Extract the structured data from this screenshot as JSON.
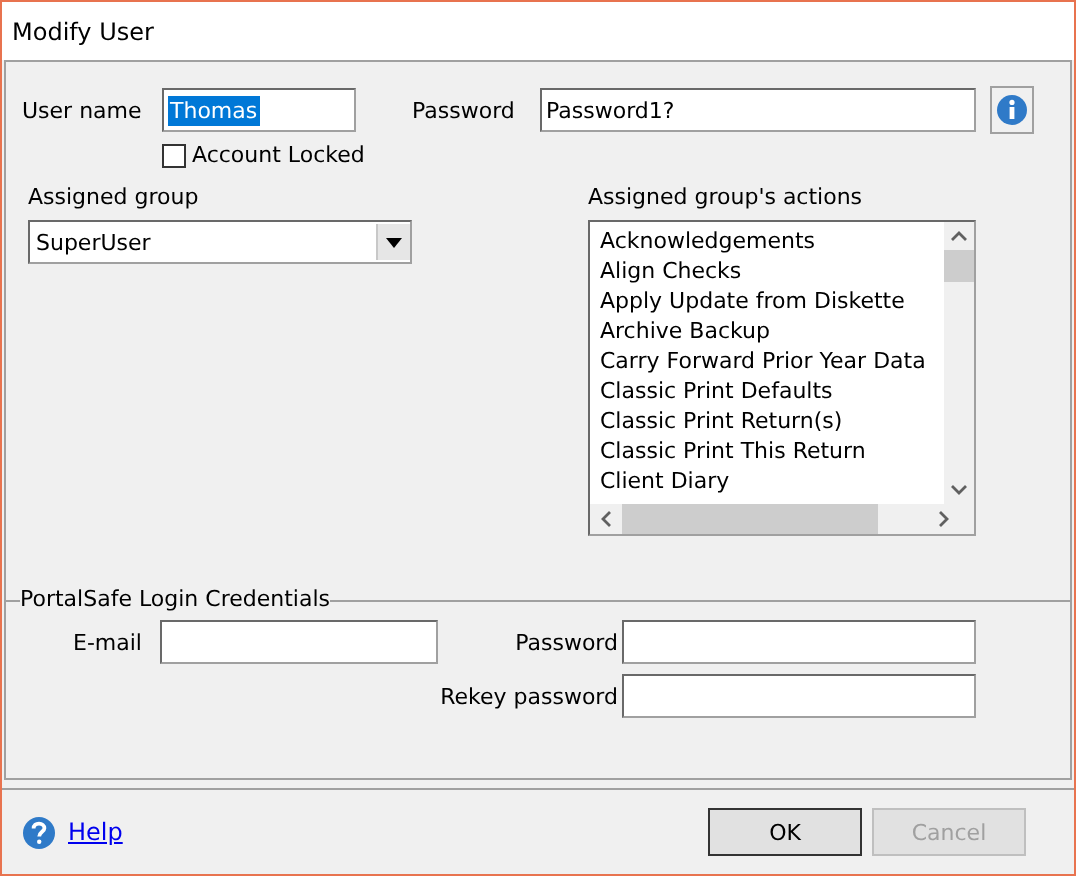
{
  "window": {
    "title": "Modify User"
  },
  "user_name": {
    "label": "User name",
    "value": "Thomas",
    "text_selected": true
  },
  "password": {
    "label": "Password",
    "value": "Password1?"
  },
  "account_locked": {
    "label": "Account Locked",
    "checked": false
  },
  "assigned_group": {
    "label": "Assigned group",
    "value": "SuperUser"
  },
  "actions": {
    "label": "Assigned group's actions",
    "items": [
      "Acknowledgements",
      "Align Checks",
      "Apply Update from Diskette",
      "Archive Backup",
      "Carry Forward Prior Year Data",
      "Classic Print Defaults",
      "Classic Print Return(s)",
      "Classic Print This Return",
      "Client Diary"
    ]
  },
  "portalsafe": {
    "legend": "PortalSafe Login Credentials",
    "email_label": "E-mail",
    "password_label": "Password",
    "rekey_label": "Rekey password"
  },
  "help": {
    "label": "Help"
  },
  "buttons": [
    {
      "label": "OK",
      "disabled": false
    },
    {
      "label": "Cancel",
      "disabled": true
    }
  ]
}
